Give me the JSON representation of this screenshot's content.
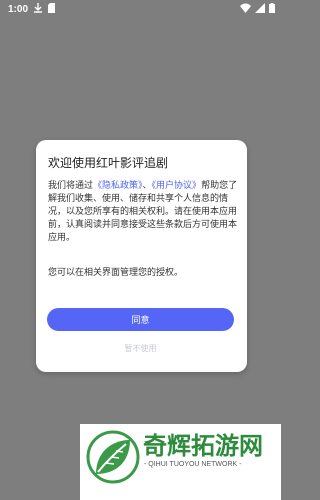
{
  "status_bar": {
    "time": "1:00",
    "icons": [
      "download-icon",
      "sd-card-icon",
      "wifi-icon",
      "signal-icon",
      "battery-icon"
    ]
  },
  "dialog": {
    "title": "欢迎使用红叶影评追剧",
    "body_prefix": "我们将通过",
    "privacy_link": "《隐私政策》",
    "separator": "、",
    "terms_link": "《用户协议》",
    "body_suffix": "帮助您了解我们收集、使用、储存和共享个人信息的情况，以及您所享有的相关权利。请在使用本应用前，认真阅读并同意接受这些条款后方可使用本应用。",
    "note": "您可以在相关界面管理您的授权。",
    "agree_label": "同意",
    "decline_label": "暂不使用"
  },
  "watermark": {
    "title": "奇辉拓游网",
    "subtitle": "- QIHUI TUOYOU NETWORK -"
  },
  "colors": {
    "overlay": "#7e7e7e",
    "accent": "#5566f6",
    "link": "#4e63f5",
    "brand_green": "#2e8a3c"
  }
}
